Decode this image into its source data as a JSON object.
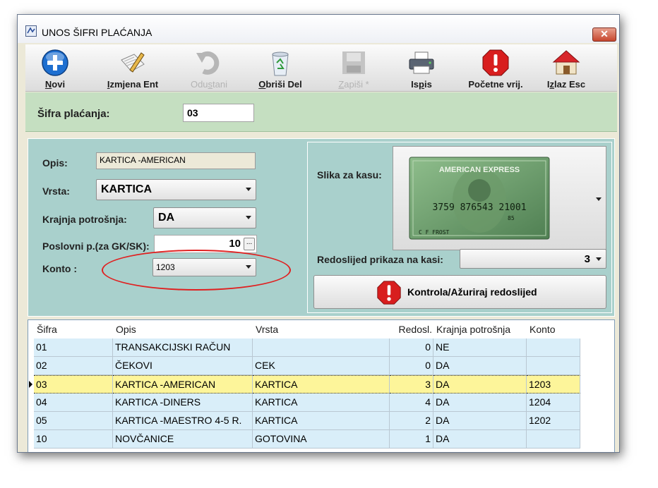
{
  "window": {
    "title": "UNOS ŠIFRI PLAĆANJA",
    "close_label": "✕"
  },
  "toolbar": {
    "novi": {
      "pre": "",
      "ul": "N",
      "post": "ovi"
    },
    "izmjena": {
      "pre": "",
      "ul": "I",
      "post": "zmjena Ent"
    },
    "odustani": {
      "pre": "Odu",
      "ul": "s",
      "post": "tani"
    },
    "obrisi": {
      "pre": "",
      "ul": "O",
      "post": "briši Del"
    },
    "zapisi": {
      "pre": "",
      "ul": "Z",
      "post": "apiši *"
    },
    "ispis": {
      "pre": "Is",
      "ul": "p",
      "post": "is"
    },
    "pocetne": {
      "label": "Početne vrij."
    },
    "izlaz": {
      "pre": "I",
      "ul": "z",
      "post": "laz Esc"
    }
  },
  "header": {
    "sifra_label": "Šifra plaćanja:",
    "sifra_value": "03"
  },
  "form": {
    "opis_label": "Opis:",
    "opis_value": "KARTICA -AMERICAN",
    "vrsta_label": "Vrsta:",
    "vrsta_value": "KARTICA",
    "krajnja_label": "Krajnja potrošnja:",
    "krajnja_value": "DA",
    "poslovni_label": "Poslovni p.(za GK/SK):",
    "poslovni_value": "10",
    "poslovni_btn": "...",
    "konto_label": "Konto :",
    "konto_value": "1203",
    "slika_label": "Slika za kasu:",
    "card": {
      "brand": "AMERICAN EXPRESS",
      "number": "3759 876543 21001",
      "small": "85",
      "holder": "C F FROST"
    },
    "redoslijed_label": "Redoslijed prikaza na kasi:",
    "redoslijed_value": "3",
    "kontrola_button": "Kontrola/Ažuriraj redoslijed"
  },
  "grid": {
    "columns": [
      "Šifra",
      "Opis",
      "Vrsta",
      "Redosl.",
      "Krajnja potrošnja",
      "Konto"
    ],
    "rows": [
      {
        "sifra": "01",
        "opis": "TRANSAKCIJSKI RAČUN",
        "vrsta": "",
        "redosl": "0",
        "krajnja": "NE",
        "konto": ""
      },
      {
        "sifra": "02",
        "opis": "ČEKOVI",
        "vrsta": "CEK",
        "redosl": "0",
        "krajnja": "DA",
        "konto": ""
      },
      {
        "sifra": "03",
        "opis": "KARTICA -AMERICAN",
        "vrsta": "KARTICA",
        "redosl": "3",
        "krajnja": "DA",
        "konto": "1203"
      },
      {
        "sifra": "04",
        "opis": "KARTICA -DINERS",
        "vrsta": "KARTICA",
        "redosl": "4",
        "krajnja": "DA",
        "konto": "1204"
      },
      {
        "sifra": "05",
        "opis": "KARTICA -MAESTRO 4-5 R.",
        "vrsta": "KARTICA",
        "redosl": "2",
        "krajnja": "DA",
        "konto": "1202"
      },
      {
        "sifra": "10",
        "opis": "NOVČANICE",
        "vrsta": "GOTOVINA",
        "redosl": "1",
        "krajnja": "DA",
        "konto": ""
      }
    ],
    "selected_index": 2
  },
  "colors": {
    "accent_blue": "#1e6fd0",
    "stop_red": "#d81e1e",
    "selected_row": "#fdf59a",
    "alt_row": "#d9eef9",
    "annotation": "#e02020"
  },
  "icons": [
    "add-icon",
    "edit-icon",
    "undo-icon",
    "recycle-bin-icon",
    "save-icon",
    "printer-icon",
    "stop-icon",
    "home-icon"
  ]
}
